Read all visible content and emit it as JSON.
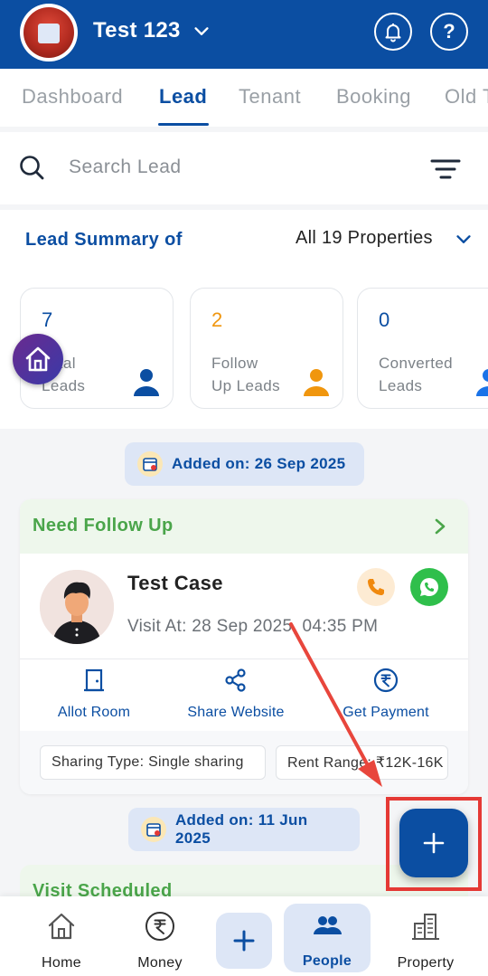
{
  "header": {
    "account_name": "Test 123",
    "help_label": "?"
  },
  "tabs": [
    "Dashboard",
    "Lead",
    "Tenant",
    "Booking",
    "Old T"
  ],
  "active_tab": "Lead",
  "search": {
    "placeholder": "Search Lead",
    "value": ""
  },
  "summary": {
    "title": "Lead Summary of",
    "property_filter": "All 19 Properties",
    "cards": [
      {
        "count": "7",
        "label_line1": "Total",
        "label_line2": "Leads",
        "color": "#0b4ea2",
        "icon_color": "#0b4ea2"
      },
      {
        "count": "2",
        "label_line1": "Follow",
        "label_line2": "Up Leads",
        "color": "#f0960e",
        "icon_color": "#f0960e"
      },
      {
        "count": "0",
        "label_line1": "Converted",
        "label_line2": "Leads",
        "color": "#0b4ea2",
        "icon_color": "#1a73e8"
      }
    ]
  },
  "groups": [
    {
      "added_on": "Added on: 26 Sep 2025",
      "lead": {
        "status": "Need Follow Up",
        "name": "Test Case",
        "visit_at": "Visit At: 28 Sep 2025, 04:35 PM",
        "actions": [
          "Allot Room",
          "Share Website",
          "Get Payment"
        ],
        "tags": [
          "Sharing Type: Single sharing",
          "Rent Range: ₹12K-16K"
        ]
      }
    },
    {
      "added_on": "Added on: 11 Jun 2025",
      "lead": {
        "status": "Visit Scheduled"
      }
    }
  ],
  "bottom_nav": {
    "items": [
      "Home",
      "Money",
      "People",
      "Property"
    ],
    "active": "People"
  },
  "colors": {
    "brand": "#0b4ea2",
    "status_green": "#4aa54a",
    "highlight": "#e53935"
  }
}
